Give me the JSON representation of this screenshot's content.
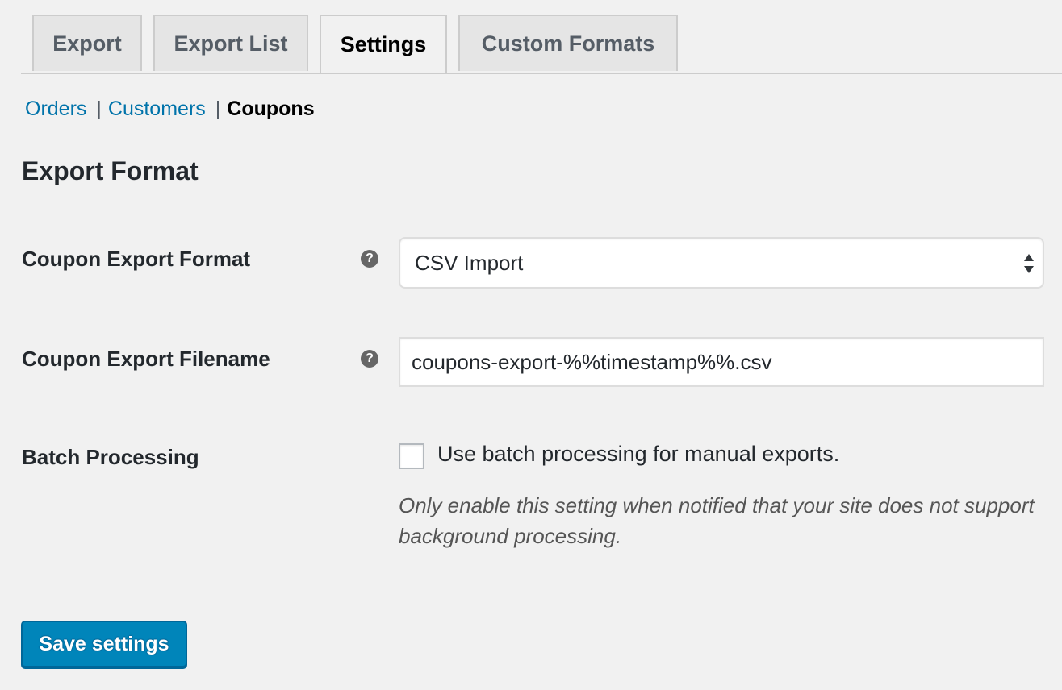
{
  "tabs": [
    {
      "label": "Export",
      "active": false
    },
    {
      "label": "Export List",
      "active": false
    },
    {
      "label": "Settings",
      "active": true
    },
    {
      "label": "Custom Formats",
      "active": false
    }
  ],
  "subnav": {
    "orders": "Orders",
    "customers": "Customers",
    "coupons": "Coupons",
    "separator": "|"
  },
  "section": {
    "title": "Export Format"
  },
  "fields": {
    "format": {
      "label": "Coupon Export Format",
      "value": "CSV Import",
      "help_icon": "question-mark-icon"
    },
    "filename": {
      "label": "Coupon Export Filename",
      "value": "coupons-export-%%timestamp%%.csv",
      "help_icon": "question-mark-icon"
    },
    "batch": {
      "label": "Batch Processing",
      "checkbox_label": "Use batch processing for manual exports.",
      "checked": false,
      "description": "Only enable this setting when notified that your site does not support background processing."
    }
  },
  "help_glyph": "?",
  "save_button": "Save settings",
  "colors": {
    "link": "#0073aa",
    "button": "#0085ba",
    "background": "#f1f1f1"
  }
}
